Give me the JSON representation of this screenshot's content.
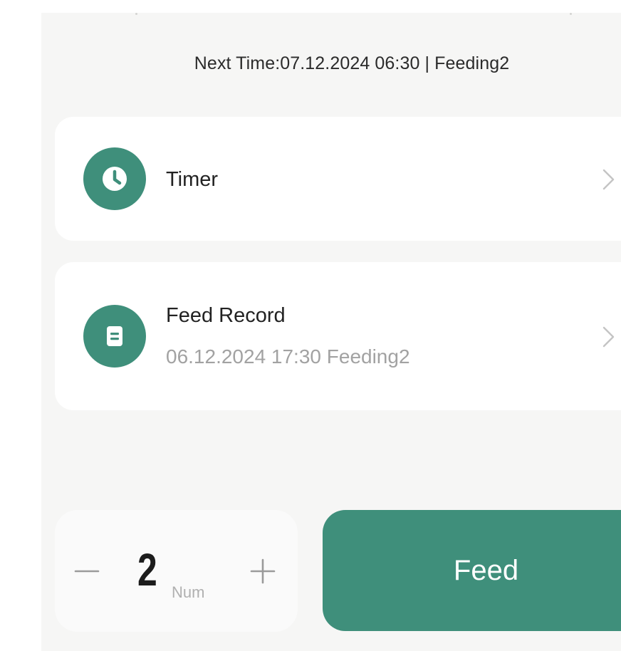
{
  "header": {
    "next_time": "Next Time:07.12.2024 06:30 | Feeding2"
  },
  "timer_card": {
    "title": "Timer",
    "icon": "clock-icon"
  },
  "record_card": {
    "title": "Feed Record",
    "last_record": "06.12.2024 17:30 Feeding2",
    "icon": "document-icon"
  },
  "feed_controls": {
    "quantity": "2",
    "unit": "Num",
    "feed_label": "Feed",
    "minus_icon": "minus-icon",
    "plus_icon": "plus-icon"
  },
  "colors": {
    "accent": "#3f8f7b",
    "panel_background": "#f6f6f5",
    "card_background": "#ffffff",
    "secondary_text": "#a2a2a2"
  }
}
